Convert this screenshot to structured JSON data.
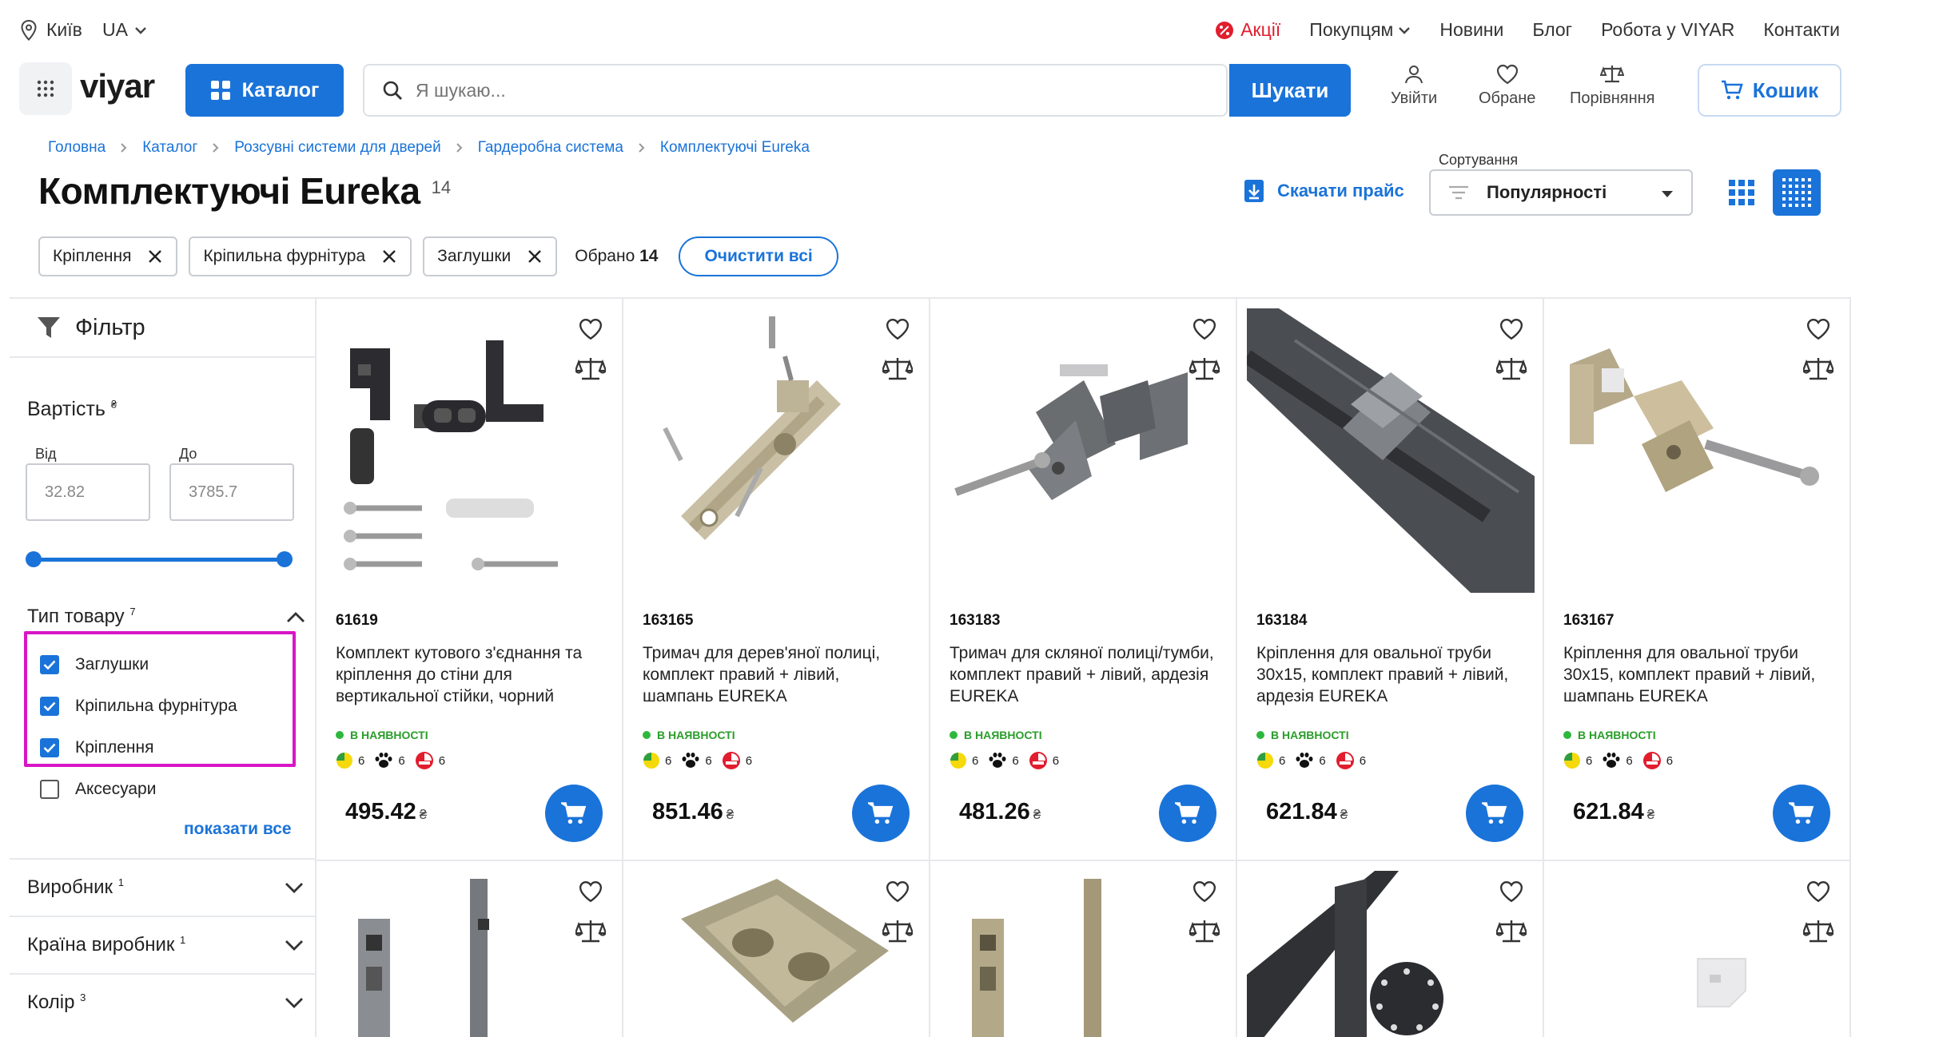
{
  "topbar": {
    "city": "Київ",
    "language": "UA",
    "nav": {
      "promo": "Акції",
      "buyers": "Покупцям",
      "news": "Новини",
      "blog": "Блог",
      "careers": "Робота у VIYAR",
      "contacts": "Контакти"
    },
    "promo_color": "#e11d2e"
  },
  "header": {
    "logo": "viyar",
    "catalog_label": "Каталог",
    "search_placeholder": "Я шукаю...",
    "search_button": "Шукати",
    "login": "Увійти",
    "favorites": "Обране",
    "compare": "Порівняння",
    "cart": "Кошик",
    "accent_color": "#1a73d9"
  },
  "breadcrumb": [
    "Головна",
    "Каталог",
    "Розсувні системи для дверей",
    "Гардеробна система",
    "Комплектуючі Eureka"
  ],
  "page_title": "Комплектуючі Eureka",
  "product_count": "14",
  "download_price": "Скачати прайс",
  "sort": {
    "label": "Сортування",
    "value": "Популярності"
  },
  "active_filters": {
    "chips": [
      "Кріплення",
      "Кріпильна фурнітура",
      "Заглушки"
    ],
    "chosen_label": "Обрано",
    "chosen_count": "14",
    "clear_all": "Очистити всі"
  },
  "sidebar": {
    "title": "Фільтр",
    "price": {
      "title": "Вартість",
      "currency": "₴",
      "from_label": "Від",
      "to_label": "До",
      "from_value": "32.82",
      "to_value": "3785.7"
    },
    "product_type": {
      "title": "Тип товару",
      "count": "7",
      "options": [
        {
          "label": "Заглушки",
          "checked": true
        },
        {
          "label": "Кріпильна фурнітура",
          "checked": true
        },
        {
          "label": "Кріплення",
          "checked": true
        },
        {
          "label": "Аксесуари",
          "checked": false
        }
      ],
      "show_all": "показати все"
    },
    "sections": [
      {
        "title": "Виробник",
        "count": "1"
      },
      {
        "title": "Країна виробник",
        "count": "1"
      },
      {
        "title": "Колір",
        "count": "3"
      }
    ]
  },
  "products": [
    {
      "code": "61619",
      "name": "Комплект кутового з'єднання та кріплення до стіни для вертикальної стійки, чорний",
      "stock": "В НАЯВНОСТІ",
      "badges": [
        "6",
        "6",
        "6"
      ],
      "price": "495.42",
      "currency": "₴"
    },
    {
      "code": "163165",
      "name": "Тримач для дерев'яної полиці, комплект правий + лівий, шампань EUREKA",
      "stock": "В НАЯВНОСТІ",
      "badges": [
        "6",
        "6",
        "6"
      ],
      "price": "851.46",
      "currency": "₴"
    },
    {
      "code": "163183",
      "name": "Тримач для скляної полиці/тумби, комплект правий + лівий, ардезія EUREKA",
      "stock": "В НАЯВНОСТІ",
      "badges": [
        "6",
        "6",
        "6"
      ],
      "price": "481.26",
      "currency": "₴"
    },
    {
      "code": "163184",
      "name": "Кріплення для овальної труби 30х15, комплект правий + лівий, ардезія EUREKA",
      "stock": "В НАЯВНОСТІ",
      "badges": [
        "6",
        "6",
        "6"
      ],
      "price": "621.84",
      "currency": "₴"
    },
    {
      "code": "163167",
      "name": "Кріплення для овальної труби 30х15, комплект правий + лівий, шампань EUREKA",
      "stock": "В НАЯВНОСТІ",
      "badges": [
        "6",
        "6",
        "6"
      ],
      "price": "621.84",
      "currency": "₴"
    }
  ],
  "stock_color": "#2db83d",
  "highlight_color": "#d816c6"
}
